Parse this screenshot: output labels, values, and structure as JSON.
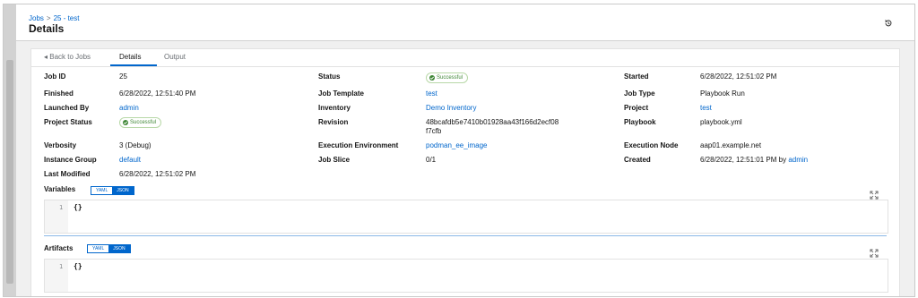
{
  "header": {
    "breadcrumb": {
      "jobs": "Jobs",
      "separator": ">",
      "current": "25 - test"
    },
    "title": "Details",
    "history_icon": "history-icon"
  },
  "tabs": [
    {
      "label": "◂ Back to Jobs"
    },
    {
      "label": "Details",
      "active": true
    },
    {
      "label": "Output"
    }
  ],
  "details": {
    "job_id": {
      "label": "Job ID",
      "value": "25"
    },
    "status": {
      "label": "Status",
      "value": "Successful"
    },
    "started": {
      "label": "Started",
      "value": "6/28/2022, 12:51:02 PM"
    },
    "finished": {
      "label": "Finished",
      "value": "6/28/2022, 12:51:40 PM"
    },
    "job_template": {
      "label": "Job Template",
      "value": "test"
    },
    "job_type": {
      "label": "Job Type",
      "value": "Playbook Run"
    },
    "launched_by": {
      "label": "Launched By",
      "value": "admin"
    },
    "inventory": {
      "label": "Inventory",
      "value": "Demo Inventory"
    },
    "project": {
      "label": "Project",
      "value": "test"
    },
    "project_status": {
      "label": "Project Status",
      "value": "Successful"
    },
    "revision": {
      "label": "Revision",
      "value": "48bcafdb5e7410b01928aa43f166d2ecf08f7cfb"
    },
    "playbook": {
      "label": "Playbook",
      "value": "playbook.yml"
    },
    "verbosity": {
      "label": "Verbosity",
      "value": "3 (Debug)"
    },
    "execution_environment": {
      "label": "Execution Environment",
      "value": "podman_ee_image"
    },
    "execution_node": {
      "label": "Execution Node",
      "value": "aap01.example.net"
    },
    "instance_group": {
      "label": "Instance Group",
      "value": "default"
    },
    "job_slice": {
      "label": "Job Slice",
      "value": "0/1"
    },
    "created": {
      "label": "Created",
      "value": "6/28/2022, 12:51:01 PM by",
      "user": "admin"
    },
    "last_modified": {
      "label": "Last Modified",
      "value": "6/28/2022, 12:51:02 PM"
    }
  },
  "variables": {
    "label": "Variables",
    "yaml": "YAML",
    "json": "JSON",
    "line_no": "1",
    "code": "{}"
  },
  "artifacts": {
    "label": "Artifacts",
    "yaml": "YAML",
    "json": "JSON",
    "line_no": "1",
    "code": "{}"
  },
  "colors": {
    "link": "#0066cc",
    "success": "#3e8635",
    "toggle_active": "#0066cc"
  }
}
